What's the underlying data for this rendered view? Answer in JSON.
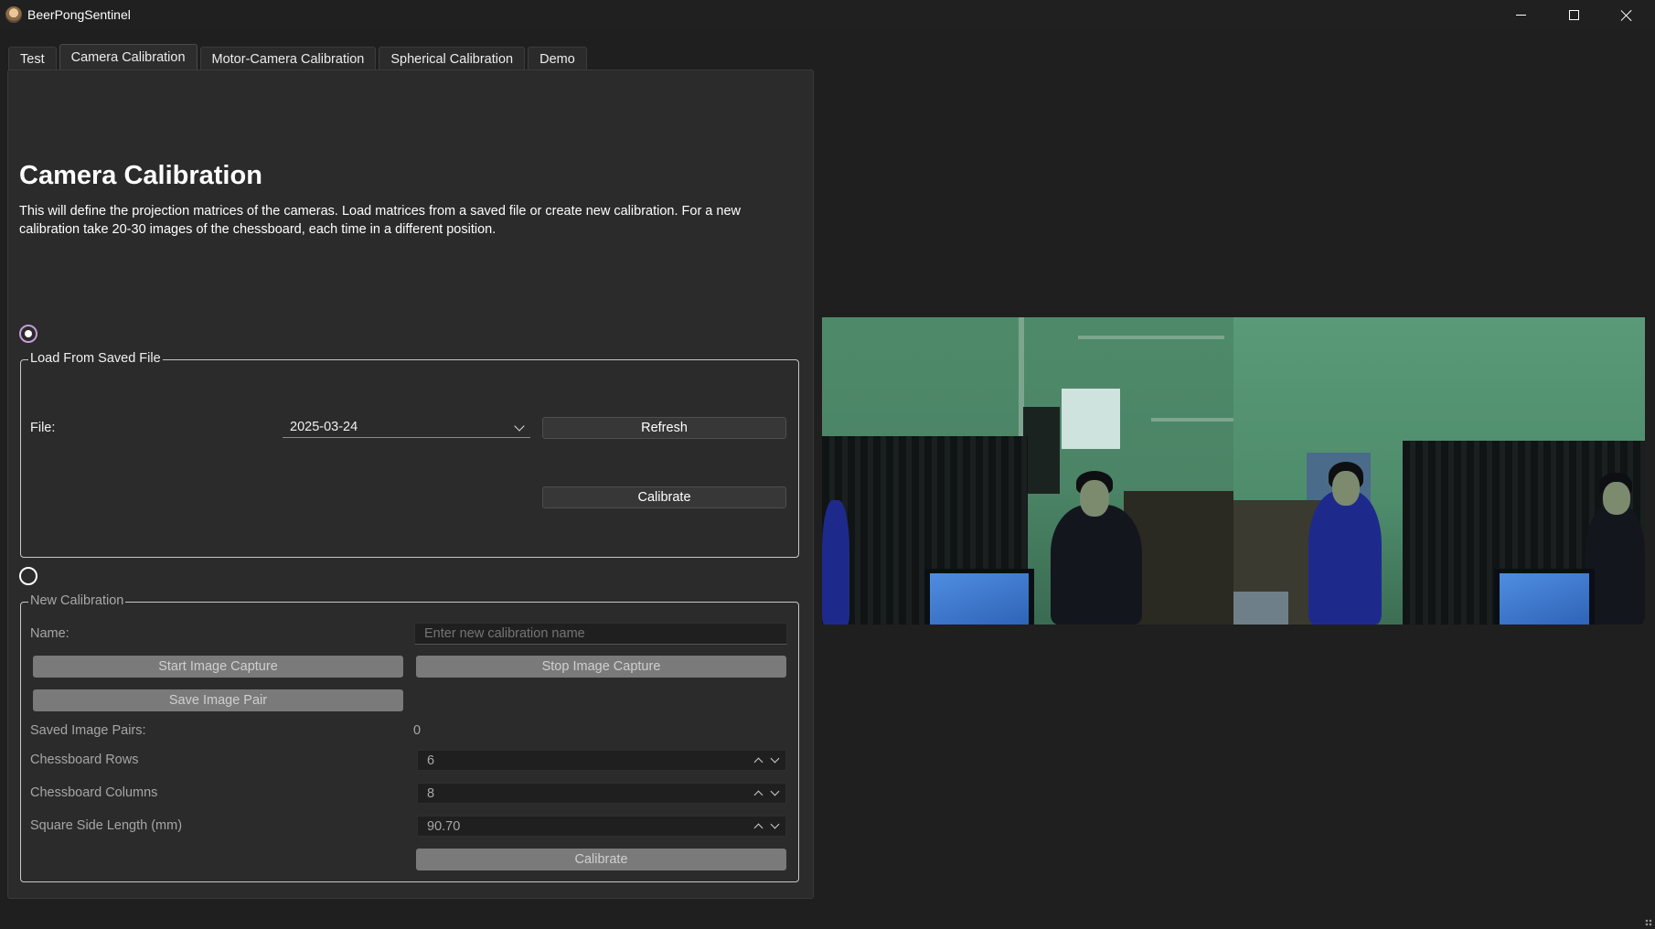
{
  "window": {
    "title": "BeerPongSentinel",
    "controls": [
      "minimize-icon",
      "maximize-icon",
      "close-icon"
    ]
  },
  "tabs": [
    {
      "label": "Test",
      "active": false
    },
    {
      "label": "Camera Calibration",
      "active": true
    },
    {
      "label": "Motor-Camera Calibration",
      "active": false
    },
    {
      "label": "Spherical Calibration",
      "active": false
    },
    {
      "label": "Demo",
      "active": false
    }
  ],
  "page": {
    "title": "Camera Calibration",
    "description": "This will define the projection matrices of the cameras. Load matrices from a saved file or create new calibration. For a new calibration take 20-30 images of the chessboard, each time in a different position."
  },
  "load_section": {
    "selected": true,
    "legend": "Load From Saved File",
    "file_label": "File:",
    "file_value": "2025-03-24",
    "refresh_label": "Refresh",
    "calibrate_label": "Calibrate"
  },
  "new_section": {
    "selected": false,
    "legend": "New Calibration",
    "name_label": "Name:",
    "name_placeholder": "Enter new calibration name",
    "start_capture_label": "Start Image Capture",
    "stop_capture_label": "Stop Image Capture",
    "save_pair_label": "Save Image Pair",
    "saved_pairs_label": "Saved Image Pairs:",
    "saved_pairs_value": "0",
    "rows_label": "Chessboard Rows",
    "rows_value": "6",
    "columns_label": "Chessboard Columns",
    "columns_value": "8",
    "square_label": "Square Side Length (mm)",
    "square_value": "90.70",
    "calibrate_label": "Calibrate"
  },
  "colors": {
    "background": "#1f1f1f",
    "panel": "#2b2b2b",
    "radio_accent": "#c79bd9",
    "disabled_button": "#7a7a7a"
  }
}
